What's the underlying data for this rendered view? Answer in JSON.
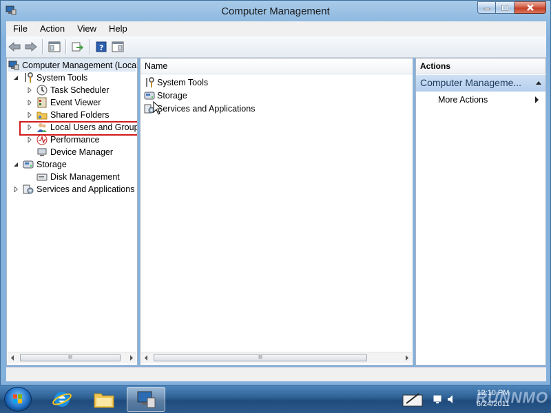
{
  "window": {
    "title": "Computer Management"
  },
  "menu": [
    "File",
    "Action",
    "View",
    "Help"
  ],
  "toolbar": {
    "buttons": [
      "back-icon",
      "forward-icon",
      "show-hide-console-tree-icon",
      "export-list-icon",
      "help-icon",
      "show-hide-action-pane-icon"
    ]
  },
  "tree": {
    "root": "Computer Management (Local",
    "items": [
      {
        "label": "System Tools",
        "level": 1,
        "expanded": true,
        "icon": "tools-icon"
      },
      {
        "label": "Task Scheduler",
        "level": 2,
        "icon": "clock-icon"
      },
      {
        "label": "Event Viewer",
        "level": 2,
        "icon": "event-viewer-icon"
      },
      {
        "label": "Shared Folders",
        "level": 2,
        "icon": "shared-folder-icon"
      },
      {
        "label": "Local Users and Groups",
        "level": 2,
        "icon": "users-icon"
      },
      {
        "label": "Performance",
        "level": 2,
        "icon": "performance-icon"
      },
      {
        "label": "Device Manager",
        "level": 2,
        "icon": "device-manager-icon"
      },
      {
        "label": "Storage",
        "level": 1,
        "expanded": true,
        "icon": "storage-icon"
      },
      {
        "label": "Disk Management",
        "level": 2,
        "icon": "disk-icon"
      },
      {
        "label": "Services and Applications",
        "level": 1,
        "icon": "services-icon"
      }
    ]
  },
  "list": {
    "header": "Name",
    "rows": [
      "System Tools",
      "Storage",
      "Services and Applications"
    ]
  },
  "actions": {
    "header": "Actions",
    "group": "Computer Manageme...",
    "link": "More Actions"
  },
  "scrollbar": {
    "grip": "III"
  },
  "taskbar": {
    "clock_time": "12:10 PM",
    "clock_date": "6/24/2011",
    "watermark": "RUNNMO"
  },
  "colors": {
    "highlight_box": "#d11a1a",
    "taskbar": "#2d5f93"
  }
}
